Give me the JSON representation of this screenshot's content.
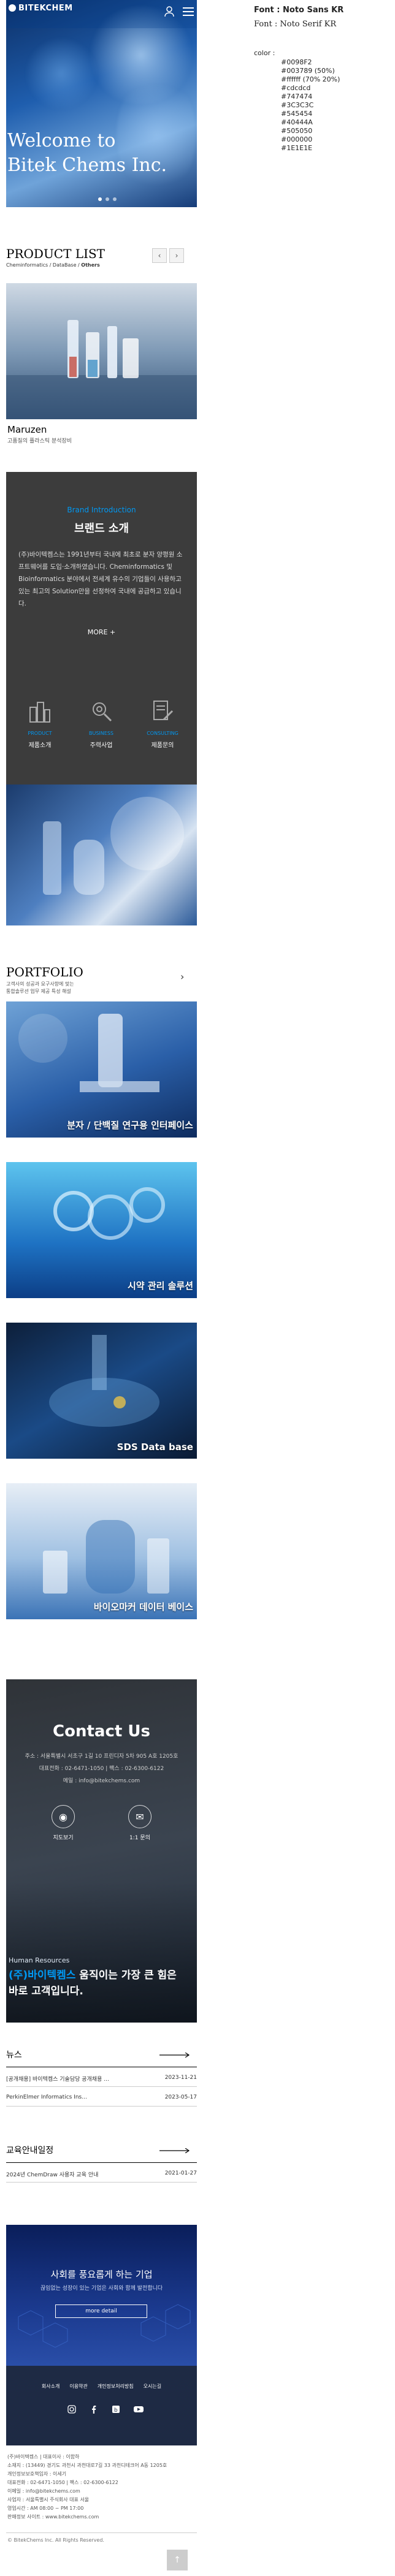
{
  "header": {
    "logo": "BITEKCHEM",
    "user_icon": "user-icon",
    "menu_icon": "hamburger-icon"
  },
  "hero": {
    "title_line1": "Welcome to",
    "title_line2": "Bitek Chems Inc."
  },
  "products": {
    "title": "PRODUCT LIST",
    "crumb_a": "Cheminformatics / DataBase / ",
    "crumb_b": "Others",
    "item_name": "Maruzen",
    "item_desc": "고품질의 플라스틱 분석장비"
  },
  "brand": {
    "en": "Brand Introduction",
    "title": "브랜드 소개",
    "body": "(주)바이텍켐스는 1991년부터 국내에 최초로 분자 양평원 소프트웨어를 도입·소개하였습니다. Cheminformatics 및 Bioinformatics 분야에서 전세계 유수의 기업들이 사용하고 있는 최고의 Solution만을 선정하여 국내에 공급하고 있습니다.",
    "more": "MORE +",
    "tiles": [
      {
        "en": "PRODUCT",
        "ko": "제품소개"
      },
      {
        "en": "BUSINESS",
        "ko": "주력사업"
      },
      {
        "en": "CONSULTING",
        "ko": "제품문의"
      }
    ]
  },
  "portfolio": {
    "title": "PORTFOLIO",
    "desc_line1": "고객사의 성공과 요구사항에 맞는",
    "desc_line2": "통합솔루션 업무 제공 특성 해설",
    "items": [
      "분자 / 단백질 연구용 인터페이스",
      "시약 관리 솔루션",
      "SDS Data base",
      "바이오마커 데이터 베이스"
    ]
  },
  "contact": {
    "title": "Contact Us",
    "addr": "주소 : 서울특별시 서초구 1길 10 프린디자 5차 905 A호 1205호",
    "tel": "대표전화 : 02-6471-1050 | 팩스 : 02-6300-6122",
    "mail": "메일 : info@bitekchems.com",
    "map_label": "지도보기",
    "mail_label": "1:1 문의",
    "hr_en": "Human Resources",
    "hr_ko_a": "(주)바이텍켐스",
    "hr_ko_b": " 움직이는 가장 큰 힘은",
    "hr_ko_c": "바로 고객입니다."
  },
  "news": {
    "title": "뉴스",
    "rows": [
      {
        "text": "[공개채용] 바이텍켐스 기술담당 공개채용 ...",
        "date": "2023-11-21"
      },
      {
        "text": "PerkinElmer Informatics Ins...",
        "date": "2023-05-17"
      }
    ]
  },
  "edu": {
    "title": "교육안내일정",
    "rows": [
      {
        "text": "2024년 ChemDraw 사용자 교육 안내",
        "date": "2021-01-27"
      }
    ]
  },
  "banner": {
    "line1": "사회를 풍요롭게 하는 기업",
    "line2": "끊임없는 성장이 있는 기업은 사회와 함께 발전합니다",
    "button": "more detail"
  },
  "footer": {
    "links": [
      "회사소개",
      "이용약관",
      "개인정보처리방침",
      "오시는길"
    ]
  },
  "company": {
    "lines": [
      "(주)바이텍켐스 | 대표이사 : 이함하",
      "소재지 : (13449) 경기도 과천시 과천대로7길 33 과천디테크어 A동 1205호",
      "개인정보보호책임자 : 이세기",
      "대표전화 : 02-6471-1050 | 팩스 : 02-6300-6122",
      "이메일 : info@bitekchems.com",
      "사업자 : 서울특별시 주식회사 대표 서울",
      "영업시간 : AM 08:00 ~ PM 17:00",
      "판매정보 사이트 : www.bitekchems.com"
    ],
    "copyright": "© BitekChems Inc. All Rights Reserved."
  },
  "spec": {
    "font1": "Font : Noto Sans KR",
    "font2": "Font : Noto Serif KR",
    "color_label": "color :",
    "colors": [
      "#0098F2",
      "#003789 (50%)",
      "#ffffff (70% 20%)",
      "#cdcdcd",
      "#747474",
      "#3C3C3C",
      "#545454",
      "#40444A",
      "#505050",
      "#000000",
      "#1E1E1E"
    ]
  },
  "accent": {
    "blue": "#0098f2",
    "navy": "#003789",
    "dark": "#3c3c3c"
  }
}
